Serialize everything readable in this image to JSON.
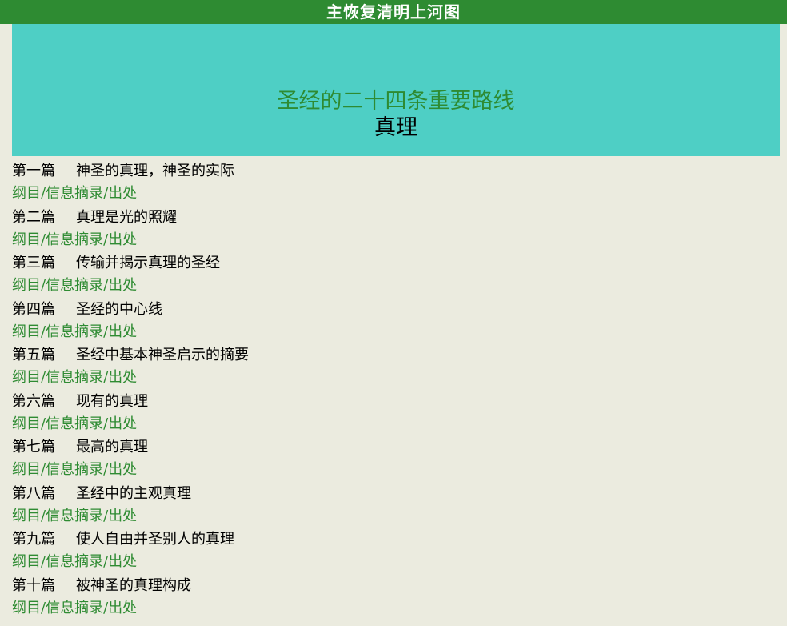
{
  "header": {
    "title": "主恢复清明上河图"
  },
  "banner": {
    "title": "圣经的二十四条重要路线",
    "subtitle": "真理"
  },
  "chapters": [
    {
      "number": "第一篇",
      "title": "神圣的真理，神圣的实际"
    },
    {
      "number": "第二篇",
      "title": "真理是光的照耀"
    },
    {
      "number": "第三篇",
      "title": "传输并揭示真理的圣经"
    },
    {
      "number": "第四篇",
      "title": "圣经的中心线"
    },
    {
      "number": "第五篇",
      "title": "圣经中基本神圣启示的摘要"
    },
    {
      "number": "第六篇",
      "title": "现有的真理"
    },
    {
      "number": "第七篇",
      "title": "最高的真理"
    },
    {
      "number": "第八篇",
      "title": "圣经中的主观真理"
    },
    {
      "number": "第九篇",
      "title": "使人自由并圣别人的真理"
    },
    {
      "number": "第十篇",
      "title": "被神圣的真理构成"
    }
  ],
  "links": {
    "outline": "纲目",
    "message_excerpt": "信息摘录",
    "source": "出处",
    "separator": "/"
  },
  "colors": {
    "header_bg": "#2E8B32",
    "banner_bg": "#4ECFC5",
    "page_bg": "#EBEBDF",
    "link_green": "#2E8B32"
  }
}
